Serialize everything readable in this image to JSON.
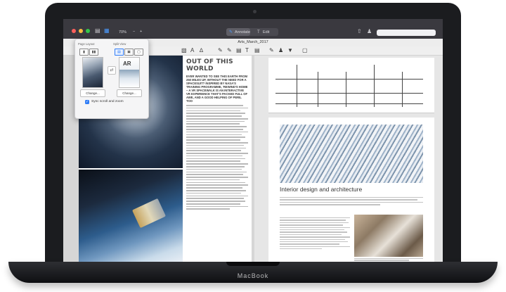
{
  "device": {
    "brand": "MacBook"
  },
  "toolbar": {
    "zoom": "70%",
    "zoom_minus": "−",
    "zoom_plus": "+",
    "mode_annotate": "Annotate",
    "mode_edit": "Edit",
    "search_placeholder": ""
  },
  "document": {
    "title": "Arts_March_2017"
  },
  "popover": {
    "page_layout_label": "Page Layout",
    "split_view_label": "Split View",
    "change_left": "Change...",
    "change_right": "Change...",
    "sync_label": "Sync scroll and zoom",
    "thumbnail_right_text": "AR"
  },
  "page_left": {
    "headline": "OUT OF THIS WORLD",
    "subhead": "EVER WANTED TO SEE THIS EARTH FROM 250 MILES UP, WITHOUT THE NEED FOR A SPACESUIT? INSPIRED BY NASA'S TRAINING PROGRAMME, 'REWIND'S HOME – A VR SPACEWALK IS AN INTERACTIVE VR EXPERIENCE THAT'S PACKED FULL OF AWE, AND A GOOD HELPING OF PERIL TOO"
  },
  "page_right": {
    "article_title": "Interior design and architecture"
  },
  "colors": {
    "accent": "#2f7cf6",
    "toolbar_bg": "#3a393f",
    "close": "#fc605c",
    "minimize": "#fdbc40",
    "zoom": "#34c84a"
  }
}
